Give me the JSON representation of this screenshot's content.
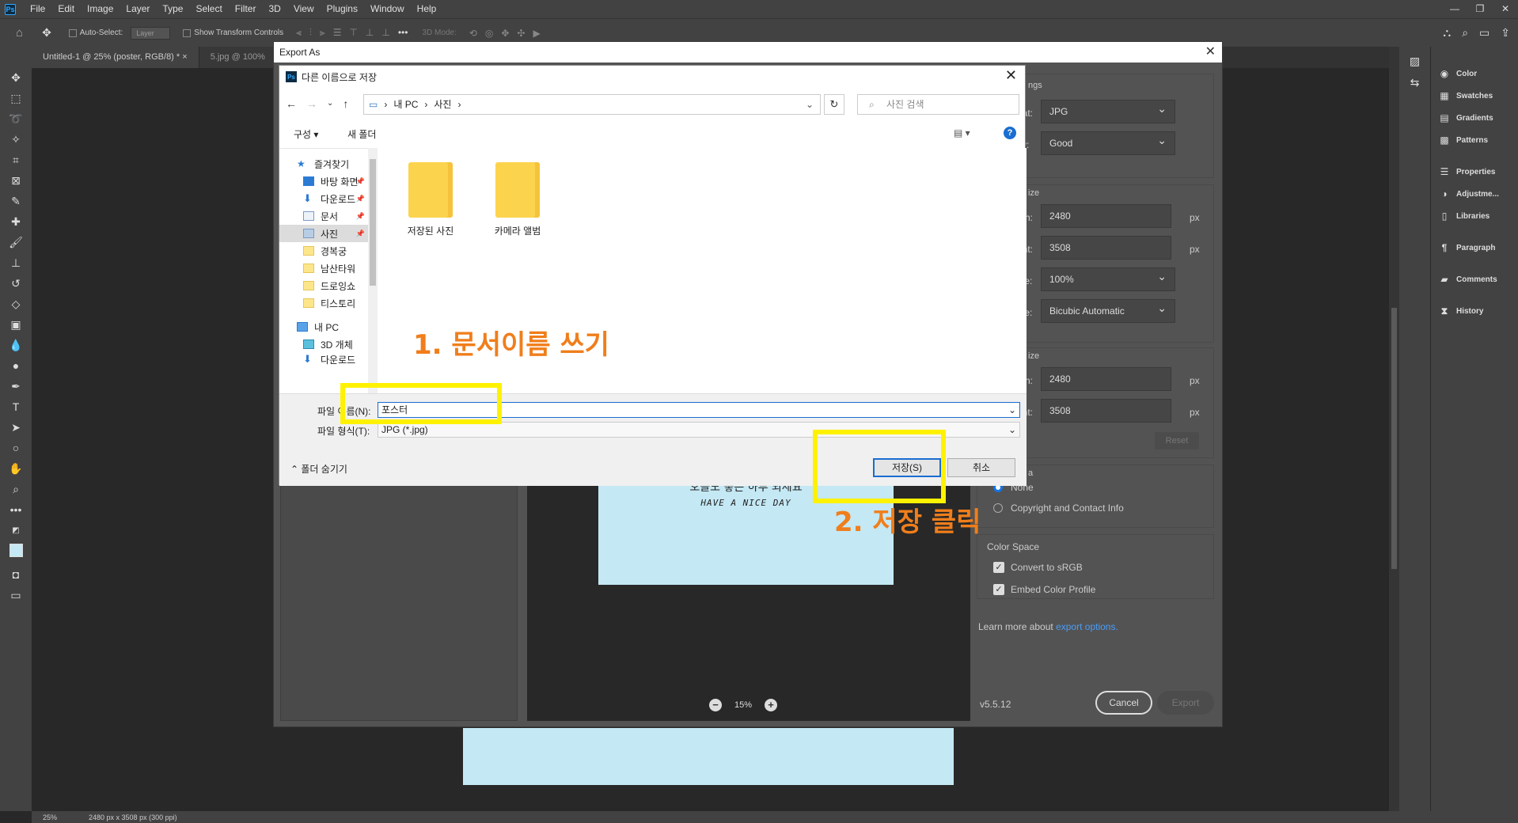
{
  "app": {
    "logo": "Ps"
  },
  "menu": [
    "File",
    "Edit",
    "Image",
    "Layer",
    "Type",
    "Select",
    "Filter",
    "3D",
    "View",
    "Plugins",
    "Window",
    "Help"
  ],
  "window_controls": {
    "minimize": "—",
    "restore": "❐",
    "close": "✕"
  },
  "options_bar": {
    "auto_select": "Auto-Select:",
    "layer_dropdown": "Layer",
    "show_transform": "Show Transform Controls",
    "mode_3d": "3D Mode:"
  },
  "tabs": [
    {
      "label": "Untitled-1 @ 25% (poster, RGB/8) *",
      "close": "×"
    },
    {
      "label": "5.jpg @ 100%"
    }
  ],
  "right_panels": [
    {
      "label": "Color",
      "icon": "color-icon"
    },
    {
      "label": "Swatches",
      "icon": "swatches-icon"
    },
    {
      "label": "Gradients",
      "icon": "gradients-icon"
    },
    {
      "label": "Patterns",
      "icon": "patterns-icon"
    },
    {
      "label": "Properties",
      "icon": "properties-icon"
    },
    {
      "label": "Adjustme...",
      "icon": "adjustments-icon"
    },
    {
      "label": "Libraries",
      "icon": "libraries-icon"
    },
    {
      "label": "Paragraph",
      "icon": "paragraph-icon"
    },
    {
      "label": "Comments",
      "icon": "comments-icon"
    },
    {
      "label": "History",
      "icon": "history-icon"
    }
  ],
  "status": {
    "zoom": "25%",
    "doc_info": "2480 px x 3508 px (300 ppi)"
  },
  "export_dialog": {
    "title": "Export As",
    "close": "✕",
    "settings_heading": "ngs",
    "format_label": "nat:",
    "format_value": "JPG",
    "quality_label": "ity:",
    "quality_value": "Good",
    "image_size_heading": "ize",
    "width_label": "dth:",
    "width_value": "2480",
    "height_label": "ght:",
    "height_value": "3508",
    "scale_label": "ale:",
    "scale_value": "100%",
    "resample_label": "ple:",
    "resample_value": "Bicubic Automatic",
    "canvas_size_heading": "ize",
    "canvas_width_value": "2480",
    "canvas_height_value": "3508",
    "unit": "px",
    "reset": "Reset",
    "metadata_heading": "a",
    "metadata_none": "None",
    "metadata_copyright": "Copyright and Contact Info",
    "color_space_heading": "Color Space",
    "convert_srgb": "Convert to sRGB",
    "embed_profile": "Embed Color Profile",
    "learn_more": "Learn more about",
    "learn_more_link": "export options.",
    "version": "v5.5.12",
    "cancel": "Cancel",
    "export": "Export",
    "preview_text_1": "오늘도 좋은 하루 되세요",
    "preview_text_2": "HAVE A NICE DAY",
    "preview_zoom": "15%",
    "zoom_out": "−",
    "zoom_in": "+"
  },
  "save_dialog": {
    "title": "다른 이름으로 저장",
    "close": "✕",
    "back": "←",
    "forward": "→",
    "recent": "⌄",
    "up": "↑",
    "breadcrumb": [
      "내 PC",
      "사진"
    ],
    "breadcrumb_sep": "›",
    "refresh": "↻",
    "search_placeholder": "사진 검색",
    "organize": "구성 ▾",
    "new_folder": "새 폴더",
    "help": "?",
    "nav": [
      {
        "label": "즐겨찾기",
        "type": "star"
      },
      {
        "label": "바탕 화면",
        "type": "desktop",
        "pinned": true
      },
      {
        "label": "다운로드",
        "type": "download",
        "pinned": true
      },
      {
        "label": "문서",
        "type": "doc",
        "pinned": true
      },
      {
        "label": "사진",
        "type": "pic",
        "pinned": true,
        "selected": true
      },
      {
        "label": "경복궁",
        "type": "folder"
      },
      {
        "label": "남산타워",
        "type": "folder"
      },
      {
        "label": "드로잉쇼",
        "type": "folder"
      },
      {
        "label": "티스토리",
        "type": "folder"
      },
      {
        "label": "내 PC",
        "type": "pc"
      },
      {
        "label": "3D 개체",
        "type": "3d"
      },
      {
        "label": "다운로드",
        "type": "download"
      }
    ],
    "folders": [
      "저장된 사진",
      "카메라 앨범"
    ],
    "filename_label": "파일 이름(N):",
    "filename_value": "포스터",
    "filetype_label": "파일 형식(T):",
    "filetype_value": "JPG (*.jpg)",
    "hide_folders": "폴더 숨기기",
    "save_button": "저장(S)",
    "cancel_button": "취소"
  },
  "annotations": {
    "step1": "1. 문서이름 쓰기",
    "step2": "2. 저장 클릭",
    "highlight_color": "#fff200",
    "text_color": "#f07e1b"
  }
}
